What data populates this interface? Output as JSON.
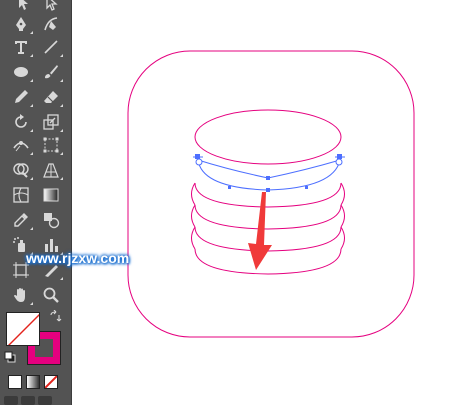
{
  "watermark": {
    "text": "www.rjzxw.com"
  },
  "colors": {
    "panel": "#535353",
    "icon": "#d8d8d8",
    "artwork_stroke": "#e5007f",
    "selection": "#4d6fff",
    "arrow": "#f03a3a"
  },
  "tools": [
    "selection-tool",
    "direct-selection-tool",
    "pen-tool",
    "curvature-tool",
    "type-tool",
    "line-segment-tool",
    "ellipse-tool",
    "paintbrush-tool",
    "pencil-tool",
    "eraser-tool",
    "rotate-tool",
    "scale-tool",
    "width-tool",
    "free-transform-tool",
    "shape-builder-tool",
    "perspective-grid-tool",
    "mesh-tool",
    "gradient-tool",
    "eyedropper-tool",
    "blend-tool",
    "symbol-sprayer-tool",
    "column-graph-tool",
    "artboard-tool",
    "slice-tool",
    "hand-tool",
    "zoom-tool"
  ],
  "fill_stroke": {
    "fill": "none",
    "stroke": "#e5007f"
  }
}
